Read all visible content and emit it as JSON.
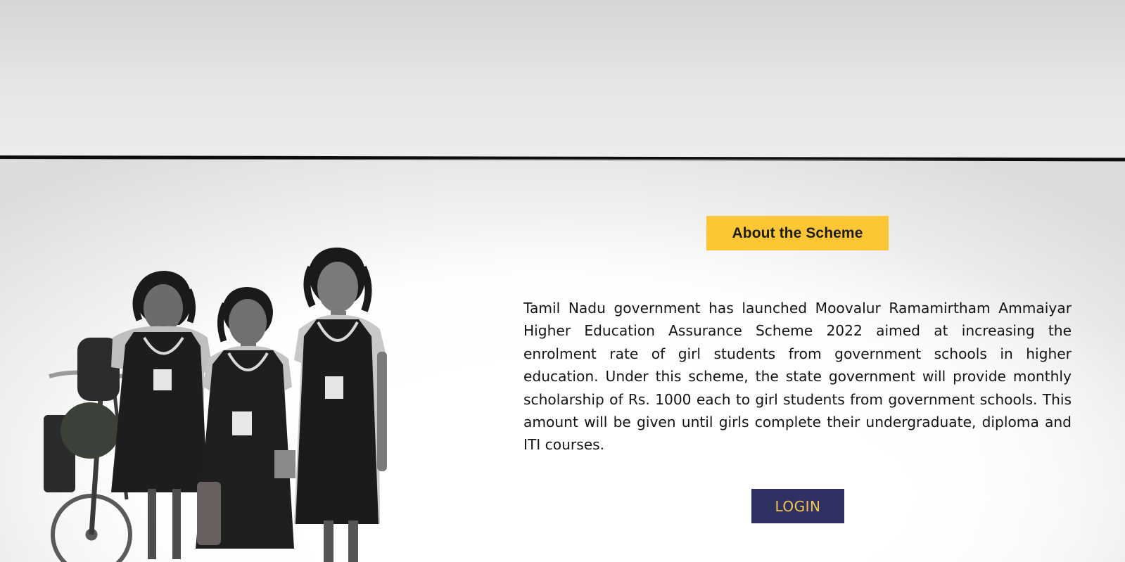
{
  "hero": {
    "about_label": "About the Scheme",
    "description": "Tamil Nadu government has launched Moovalur Ramamirtham Ammaiyar Higher Education Assurance Scheme 2022 aimed at increasing the enrolment rate of girl students from government schools in higher education. Under this scheme, the state government will provide monthly scholarship of Rs. 1000 each to girl students from government schools. This amount will be given until girls complete their undergraduate, diploma and ITI courses.",
    "login_label": "LOGIN"
  },
  "colors": {
    "badge_background": "#fcc634",
    "login_background": "#2f3163",
    "login_text": "#f4c64d",
    "divider": "#0d0d0d"
  },
  "icons": {
    "illustration": "schoolgirls-photo"
  }
}
